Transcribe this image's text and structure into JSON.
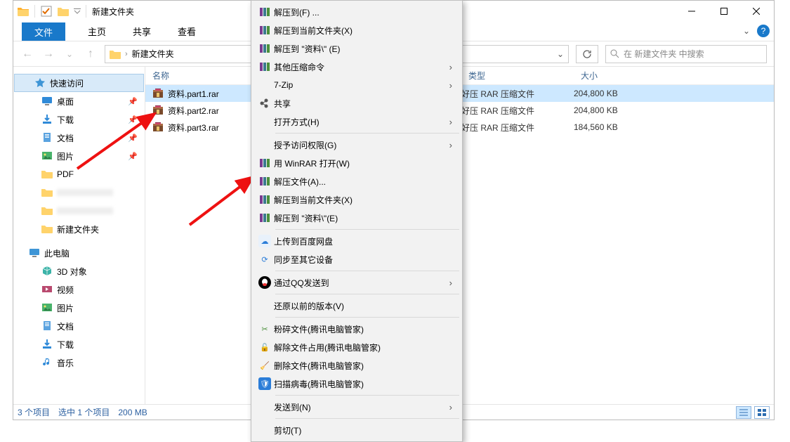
{
  "window": {
    "title": "新建文件夹"
  },
  "ribbon": {
    "file": "文件",
    "home": "主页",
    "share": "共享",
    "view": "查看"
  },
  "breadcrumb": {
    "location": "新建文件夹"
  },
  "search": {
    "placeholder": "在 新建文件夹 中搜索"
  },
  "sidebar": {
    "quick": "快速访问",
    "items": [
      {
        "icon": "desktop",
        "label": "桌面",
        "pinned": true
      },
      {
        "icon": "download",
        "label": "下载",
        "pinned": true
      },
      {
        "icon": "doc",
        "label": "文档",
        "pinned": true
      },
      {
        "icon": "pic",
        "label": "图片",
        "pinned": true
      },
      {
        "icon": "folder",
        "label": "PDF",
        "pinned": false
      },
      {
        "icon": "folder",
        "label": "",
        "pinned": false
      },
      {
        "icon": "folder",
        "label": "",
        "pinned": false
      },
      {
        "icon": "folder",
        "label": "新建文件夹",
        "pinned": false
      }
    ],
    "this_pc": "此电脑",
    "pc_items": [
      {
        "icon": "3d",
        "label": "3D 对象"
      },
      {
        "icon": "video",
        "label": "视频"
      },
      {
        "icon": "pic",
        "label": "图片"
      },
      {
        "icon": "doc",
        "label": "文档"
      },
      {
        "icon": "download",
        "label": "下载"
      },
      {
        "icon": "music",
        "label": "音乐"
      }
    ]
  },
  "columns": {
    "name": "名称",
    "type": "类型",
    "size": "大小"
  },
  "files": [
    {
      "name": "资料.part1.rar",
      "type": "好压 RAR 压缩文件",
      "size": "204,800 KB",
      "selected": true
    },
    {
      "name": "资料.part2.rar",
      "type": "好压 RAR 压缩文件",
      "size": "204,800 KB",
      "selected": false
    },
    {
      "name": "资料.part3.rar",
      "type": "好压 RAR 压缩文件",
      "size": "184,560 KB",
      "selected": false
    }
  ],
  "status": {
    "count": "3 个项目",
    "sel": "选中 1 个项目",
    "size": "200 MB"
  },
  "menu": {
    "items": [
      {
        "icon": "rar",
        "label": "解压到(F) ...",
        "arrow": false
      },
      {
        "icon": "rar",
        "label": "解压到当前文件夹(X)",
        "arrow": false
      },
      {
        "icon": "rar",
        "label": "解压到 \"资料\\\" (E)",
        "arrow": false
      },
      {
        "icon": "rar",
        "label": "其他压缩命令",
        "arrow": true
      },
      {
        "icon": "",
        "label": "7-Zip",
        "arrow": true
      },
      {
        "icon": "share",
        "label": "共享",
        "arrow": false
      },
      {
        "icon": "",
        "label": "打开方式(H)",
        "arrow": true
      },
      {
        "sep": true
      },
      {
        "icon": "",
        "label": "授予访问权限(G)",
        "arrow": true
      },
      {
        "icon": "rar",
        "label": "用 WinRAR 打开(W)",
        "arrow": false
      },
      {
        "icon": "rar",
        "label": "解压文件(A)...",
        "arrow": false
      },
      {
        "icon": "rar",
        "label": "解压到当前文件夹(X)",
        "arrow": false
      },
      {
        "icon": "rar",
        "label": "解压到 \"资料\\\"(E)",
        "arrow": false
      },
      {
        "sep": true
      },
      {
        "icon": "baidu",
        "label": "上传到百度网盘",
        "arrow": false
      },
      {
        "icon": "sync",
        "label": "同步至其它设备",
        "arrow": false
      },
      {
        "sep": true
      },
      {
        "icon": "qq",
        "label": "通过QQ发送到",
        "arrow": true
      },
      {
        "sep": true
      },
      {
        "icon": "",
        "label": "还原以前的版本(V)",
        "arrow": false
      },
      {
        "sep": true
      },
      {
        "icon": "shred",
        "label": "粉碎文件(腾讯电脑管家)",
        "arrow": false
      },
      {
        "icon": "unlock",
        "label": "解除文件占用(腾讯电脑管家)",
        "arrow": false
      },
      {
        "icon": "delete",
        "label": "删除文件(腾讯电脑管家)",
        "arrow": false
      },
      {
        "icon": "scan",
        "label": "扫描病毒(腾讯电脑管家)",
        "arrow": false
      },
      {
        "sep": true
      },
      {
        "icon": "",
        "label": "发送到(N)",
        "arrow": true
      },
      {
        "sep": true
      },
      {
        "icon": "",
        "label": "剪切(T)",
        "arrow": false
      }
    ]
  }
}
